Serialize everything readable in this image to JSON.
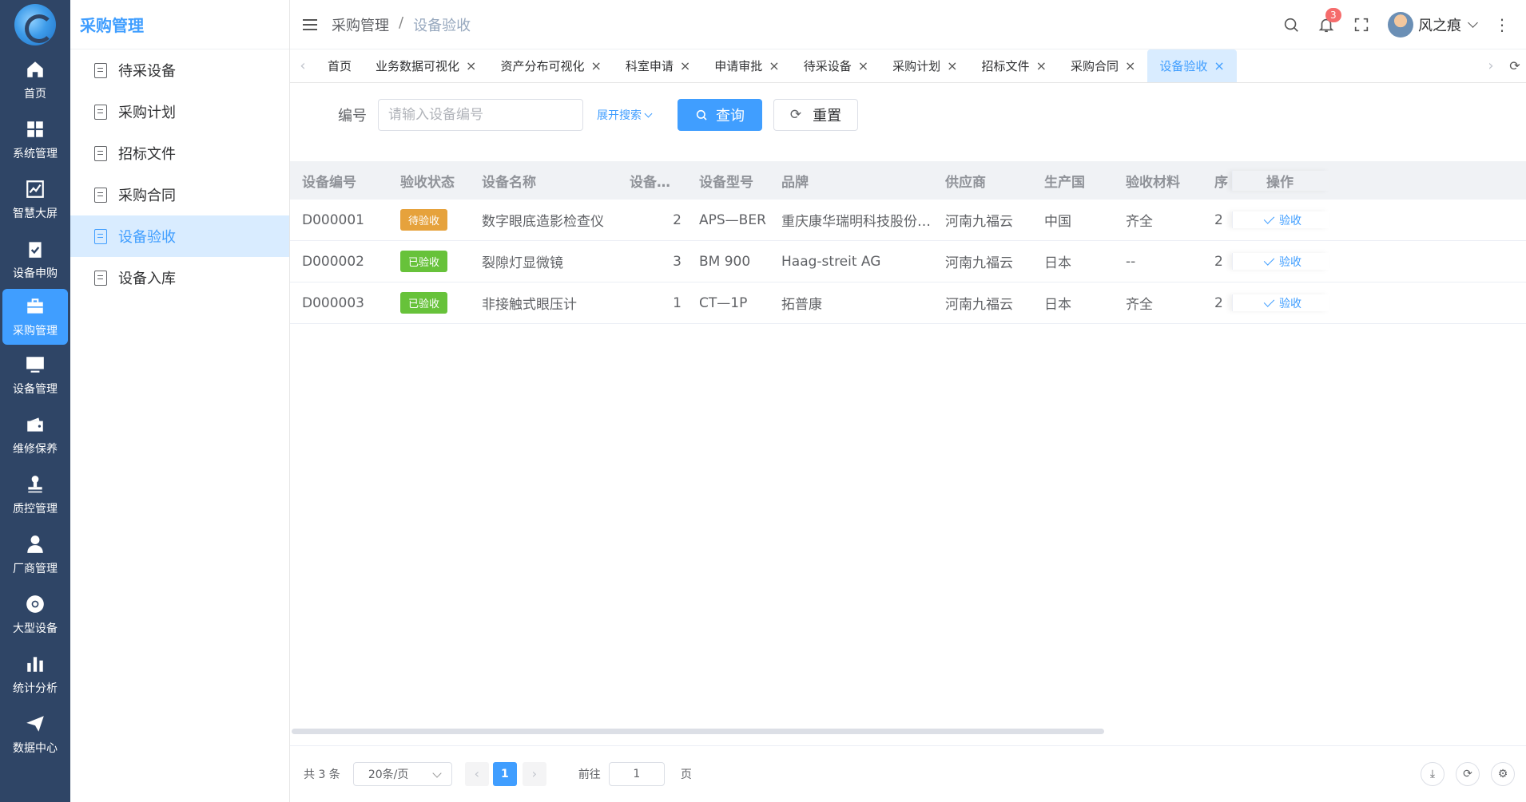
{
  "rail": {
    "items": [
      {
        "label": "首页",
        "icon": "home-icon"
      },
      {
        "label": "系统管理",
        "icon": "grid-icon"
      },
      {
        "label": "智慧大屏",
        "icon": "chart-icon"
      },
      {
        "label": "设备申购",
        "icon": "clipboard-check-icon"
      },
      {
        "label": "采购管理",
        "icon": "briefcase-icon",
        "active": true
      },
      {
        "label": "设备管理",
        "icon": "monitor-icon"
      },
      {
        "label": "维修保养",
        "icon": "wallet-icon"
      },
      {
        "label": "质控管理",
        "icon": "stamp-icon"
      },
      {
        "label": "厂商管理",
        "icon": "user-icon"
      },
      {
        "label": "大型设备",
        "icon": "chrome-icon"
      },
      {
        "label": "统计分析",
        "icon": "bar-chart-icon"
      },
      {
        "label": "数据中心",
        "icon": "send-icon"
      }
    ]
  },
  "submenu": {
    "title": "采购管理",
    "items": [
      {
        "label": "待采设备"
      },
      {
        "label": "采购计划"
      },
      {
        "label": "招标文件"
      },
      {
        "label": "采购合同"
      },
      {
        "label": "设备验收",
        "active": true
      },
      {
        "label": "设备入库"
      }
    ]
  },
  "header": {
    "breadcrumb": [
      "采购管理",
      "/",
      "设备验收"
    ],
    "notification_count": "3",
    "username": "风之痕"
  },
  "tabs": [
    {
      "label": "首页",
      "closable": false
    },
    {
      "label": "业务数据可视化",
      "closable": true
    },
    {
      "label": "资产分布可视化",
      "closable": true
    },
    {
      "label": "科室申请",
      "closable": true
    },
    {
      "label": "申请审批",
      "closable": true
    },
    {
      "label": "待采设备",
      "closable": true
    },
    {
      "label": "采购计划",
      "closable": true
    },
    {
      "label": "招标文件",
      "closable": true
    },
    {
      "label": "采购合同",
      "closable": true
    },
    {
      "label": "设备验收",
      "closable": true,
      "active": true
    }
  ],
  "search": {
    "label": "编号",
    "placeholder": "请输入设备编号",
    "expand_label": "展开搜索",
    "query_label": "查询",
    "reset_label": "重置"
  },
  "table": {
    "headers": [
      "设备编号",
      "验收状态",
      "设备名称",
      "设备数量",
      "设备型号",
      "品牌",
      "供应商",
      "生产国",
      "验收材料",
      "序",
      "操作"
    ],
    "rows": [
      {
        "id": "D000001",
        "status": "待验收",
        "status_color": "#e6a23c",
        "name": "数字眼底造影检查仪",
        "qty": "2",
        "model": "APS—BER",
        "brand": "重庆康华瑞明科技股份有…",
        "supplier": "河南九福云",
        "origin": "中国",
        "material": "齐全",
        "extra": "2",
        "action": "验收"
      },
      {
        "id": "D000002",
        "status": "已验收",
        "status_color": "#67c23a",
        "name": "裂隙灯显微镜",
        "qty": "3",
        "model": "BM 900",
        "brand": "Haag-streit AG",
        "supplier": "河南九福云",
        "origin": "日本",
        "material": "--",
        "extra": "2",
        "action": "验收"
      },
      {
        "id": "D000003",
        "status": "已验收",
        "status_color": "#67c23a",
        "name": "非接触式眼压计",
        "qty": "1",
        "model": "CT—1P",
        "brand": "拓普康",
        "supplier": "河南九福云",
        "origin": "日本",
        "material": "齐全",
        "extra": "2",
        "action": "验收"
      }
    ]
  },
  "pagination": {
    "total_text": "共 3 条",
    "page_size": "20条/页",
    "current_page": "1",
    "goto_label": "前往",
    "goto_value": "1",
    "page_suffix": "页"
  },
  "colors": {
    "primary": "#409eff",
    "rail_bg": "#2f4566",
    "pending": "#e6a23c",
    "done": "#67c23a"
  }
}
